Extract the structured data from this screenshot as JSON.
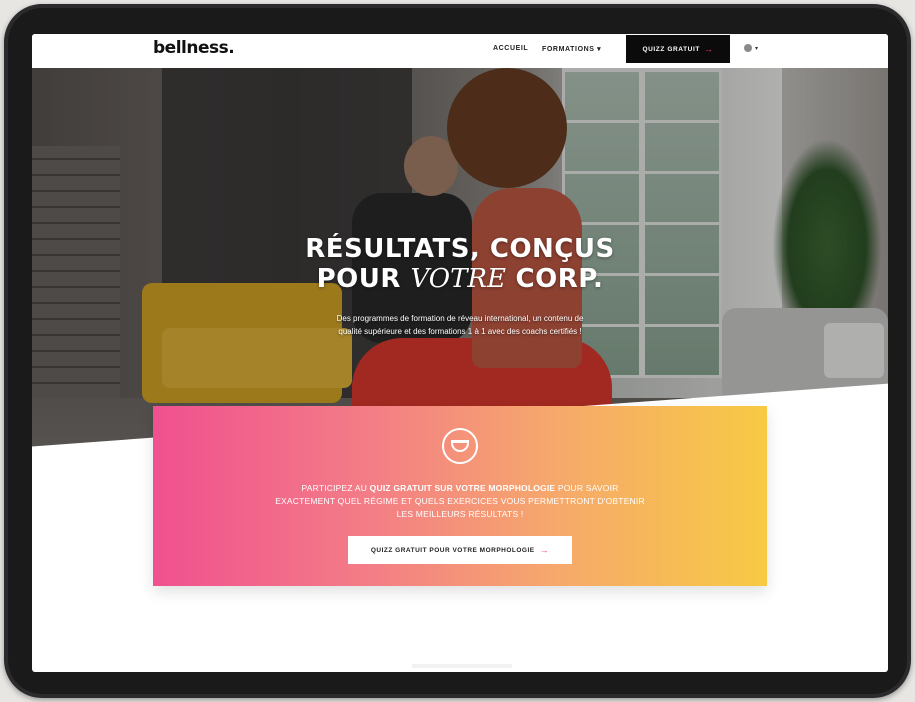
{
  "nav": {
    "logo": "bellness.",
    "links": [
      "ACCUEIL",
      "FORMATIONS ▾"
    ],
    "quiz_button": "QUIZZ GRATUIT",
    "quiz_arrow": "→",
    "lang_caret": "▾"
  },
  "hero": {
    "title_line1": "RÉSULTATS, CONÇUS",
    "title_line2_pre": "POUR ",
    "title_line2_script": "VOTRE",
    "title_line2_post": " CORP.",
    "subtitle": "Des programmes de formation de réveau international, un contenu de qualité supérieure et des formations 1 à 1 avec des coachs certifiés !"
  },
  "quiz_card": {
    "icon": "underwear-icon",
    "text_pre": "PARTICIPEZ AU ",
    "text_bold": "QUIZ GRATUIT SUR VOTRE MORPHOLOGIE",
    "text_post": " POUR SAVOIR EXACTEMENT QUEL RÉGIME ET QUELS EXERCICES VOUS PERMETTRONT D'OBTENIR LES MEILLEURS RÉSULTATS !",
    "button_label": "QUIZZ GRATUIT POUR VOTRE MORPHOLOGIE",
    "button_arrow": "→"
  },
  "colors": {
    "accent": "#ee3c7a",
    "gradient_start": "#f0508f",
    "gradient_end": "#f7ca44",
    "nav_button": "#0b0b0b"
  }
}
